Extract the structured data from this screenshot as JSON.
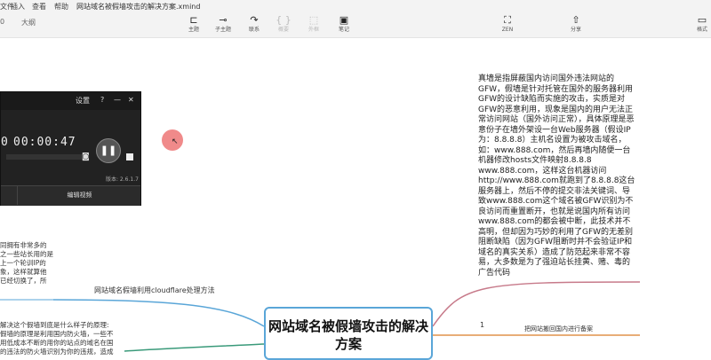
{
  "menu": {
    "items": [
      "文件",
      "编辑",
      "插入",
      "查看",
      "帮助"
    ],
    "title": "网站域名被假墙攻击的解决方案.xmind"
  },
  "tabs": {
    "first": "0",
    "second": "大纲"
  },
  "toolbar": {
    "topic": "主题",
    "subtopic": "子主题",
    "relation": "联系",
    "boundary": "概要",
    "frame": "外框",
    "note": "笔记",
    "zen": "ZEN",
    "share": "分享",
    "format": "格式"
  },
  "recorder": {
    "settings": "设置",
    "help": "?",
    "minimize": "—",
    "close": "✕",
    "time_prefix": "0",
    "time": "00:00:47",
    "version": "版本: 2.6.1.7",
    "edit_video": "编辑视频"
  },
  "notes": {
    "text": "真墙是指屏蔽国内访问国外违法网站的GFW，假墙是针对托管在国外的服务器利用GFW的设计缺陷而实施的攻击，实质是对GFW的恶意利用，现象是国内的用户无法正常访问网站（国外访问正常），具体原理是恶意份子在墙外架设一台Web服务器（假设IP为：8.8.8.8）主机名设置为被攻击域名，如：www.888.com，然后再墙内随便一台机器修改hosts文件映射8.8.8.8 www.888.com，这样这台机器访问http://www.888.com就跑到了8.8.8.8这台服务器上，然后不停的提交非法关键词、导致www.888.com这个域名被GFW识别为不良访问而重置断开，也就是说国内所有访问www.888.com的都会被中断，此技术并不高明，但却因为巧妙的利用了GFW的无差别阻断缺陷（因为GFW阻断时并不会验证IP和域名的真实关系）造成了防范起来非常不容易，大多数是为了强迫站长挂黄、赌、毒的广告代码"
  },
  "left_text_1": [
    "同拥有非常多的",
    "之一些站长用的是",
    "上一个轮训IP的",
    "象，这样就算他",
    "已经切换了，所"
  ],
  "left_text_2": [
    "解决这个假墙到底是什么样子的原理:",
    "假墙的原理是利用国内防火墙，一些不",
    "用低成本不断的用你的站点的域名在国",
    "的违法的防火墙识别为你的违规，造成"
  ],
  "branches": {
    "cloudflare": "网站域名假墙利用cloudflare处理方法",
    "central": "网站域名被假墙攻击的解决方案",
    "right_num": "1",
    "right_label": "把网站搬回国内进行备案"
  }
}
